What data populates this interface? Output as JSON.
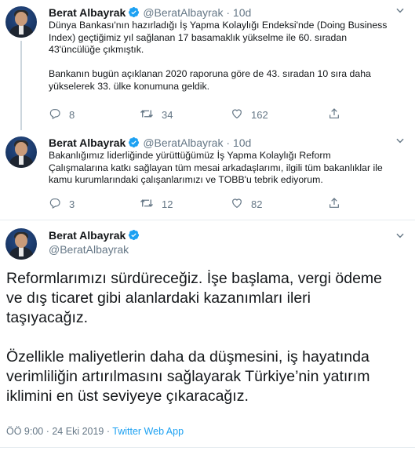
{
  "tweets": [
    {
      "name": "Berat Albayrak",
      "handle": "@BeratAlbayrak",
      "separator": "·",
      "time": "10d",
      "lines": [
        "Dünya Bankası'nın hazırladığı İş Yapma Kolaylığı Endeksi'nde (Doing Business",
        "Index) geçtiğimiz yıl sağlanan 17 basamaklık yükselme ile 60. sıradan",
        "43'üncülüğe çıkmıştık.",
        "",
        "Bankanın bugün açıklanan 2020 raporuna göre de 43. sıradan 10 sıra daha",
        "yükselerek 33. ülke konumuna geldik."
      ],
      "replies": "8",
      "retweets": "34",
      "likes": "162"
    },
    {
      "name": "Berat Albayrak",
      "handle": "@BeratAlbayrak",
      "separator": "·",
      "time": "10d",
      "lines": [
        "Bakanlığımız liderliğinde yürüttüğümüz İş Yapma Kolaylığı Reform",
        "Çalışmalarına katkı sağlayan tüm mesai arkadaşlarımı, ilgili tüm bakanlıklar ile",
        "kamu kurumlarındaki çalışanlarımızı ve TOBB'u tebrik ediyorum."
      ],
      "replies": "3",
      "retweets": "12",
      "likes": "82"
    }
  ],
  "main_tweet": {
    "name": "Berat Albayrak",
    "handle": "@BeratAlbayrak",
    "lines": [
      "Reformlarımızı sürdüreceğiz. İşe başlama, vergi ödeme",
      "ve dış ticaret gibi alanlardaki kazanımları ileri",
      "taşıyacağız.",
      "",
      "Özellikle maliyetlerin daha da düşmesini, iş hayatında",
      "verimliliğin artırılmasını sağlayarak Türkiye’nin yatırım",
      "iklimini en üst seviyeye çıkaracağız."
    ],
    "timestamp": "ÖÖ 9:00 · 24 Eki 2019 · ",
    "app": "Twitter Web App"
  },
  "colors": {
    "accent": "#1da1f2",
    "muted": "#657786",
    "text": "#14171a"
  },
  "icons": [
    "verified-icon",
    "chevron-down-icon",
    "reply-icon",
    "retweet-icon",
    "like-icon",
    "share-icon"
  ]
}
